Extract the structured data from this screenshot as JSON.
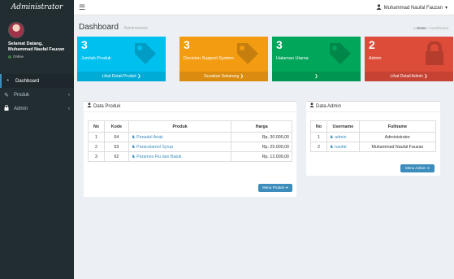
{
  "app": {
    "logo": "Administrator"
  },
  "header": {
    "user_name": "Muhammad Naufal Fauzan"
  },
  "sidebar": {
    "welcome_line1": "Selamat Datang,",
    "welcome_line2": "Muhammad Naufal Fauzan",
    "status": "Online",
    "items": [
      {
        "label": "Dashboard",
        "icon": "dashboard-icon"
      },
      {
        "label": "Produk",
        "icon": "pencil-icon"
      },
      {
        "label": "Admin",
        "icon": "lock-icon"
      }
    ]
  },
  "page": {
    "title": "Dashboard",
    "subtitle": "Administrator",
    "breadcrumb_home": "Home",
    "breadcrumb_current": "Dashboard"
  },
  "boxes": [
    {
      "value": "3",
      "label": "Jumlah Produk",
      "footer": "Lihat Detail Produk ❯",
      "color": "#00c0ef"
    },
    {
      "value": "3",
      "label": "Decision Support System",
      "footer": "Gunakan Sekarang ❯",
      "color": "#f39c12"
    },
    {
      "value": "3",
      "label": "Halaman Utama",
      "footer": "❯",
      "color": "#00a65a"
    },
    {
      "value": "2",
      "label": "Admin",
      "footer": "Lihat Detail Admin ❯",
      "color": "#dd4b39"
    }
  ],
  "produk_panel": {
    "title": "Data Produk",
    "headers": [
      "No",
      "Kode",
      "Produk",
      "Harga"
    ],
    "rows": [
      {
        "no": "1",
        "kode": "64",
        "produk": "Panadol Anak",
        "harga": "Rp. 30.000,00"
      },
      {
        "no": "2",
        "kode": "63",
        "produk": "Paracetamol Syrup",
        "harga": "Rp. 25.000,00"
      },
      {
        "no": "3",
        "kode": "62",
        "produk": "Paramex Flu dan Batuk",
        "harga": "Rp. 12.000,00"
      }
    ],
    "button": "Menu Produk"
  },
  "admin_panel": {
    "title": "Data Admin",
    "headers": [
      "No",
      "Username",
      "Fullname"
    ],
    "rows": [
      {
        "no": "1",
        "username": "admin",
        "fullname": "Administrator"
      },
      {
        "no": "2",
        "username": "naufal",
        "fullname": "Muhammad Naufal Fauzan"
      }
    ],
    "button": "Menu Admin"
  }
}
